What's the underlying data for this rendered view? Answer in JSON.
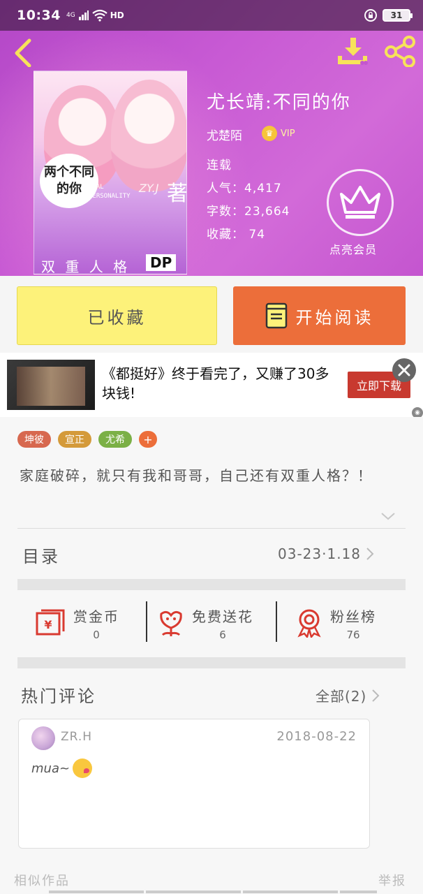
{
  "status_bar": {
    "time": "10:34",
    "network": "4G",
    "hd": "HD",
    "battery": "31"
  },
  "book": {
    "title": "尤长靖:不同的你",
    "author": "尤楚陌",
    "vip_label": "VIP",
    "status": "连载",
    "popularity": "人气：4,417",
    "word_count": "字数：23,664",
    "favorites": "收藏： 74",
    "member_label": "点亮会员",
    "cover": {
      "bubble_text": "两个不同的你",
      "subtitle": "DUAL PERSONALITY",
      "author_mark": "ZY.J",
      "zhu": "著",
      "bottom_text": "双 重 人 格",
      "dp": "DP"
    }
  },
  "actions": {
    "collect_label": "已收藏",
    "read_label": "开始阅读"
  },
  "ad": {
    "text": "《都挺好》终于看完了，又赚了30多块钱!",
    "button_label": "立即下载"
  },
  "tags": [
    {
      "label": "坤彼",
      "color": "#d7684f"
    },
    {
      "label": "宣正",
      "color": "#d49a3a"
    },
    {
      "label": "尤希",
      "color": "#7bb046"
    },
    {
      "label": "+",
      "color": "#ec6e3a"
    }
  ],
  "description": "家庭破碎，就只有我和哥哥，自己还有双重人格？！",
  "catalog": {
    "label": "目录",
    "updated": "03-23·1.18"
  },
  "stats": [
    {
      "label": "赏金币",
      "value": "0",
      "icon": "red-envelope-icon"
    },
    {
      "label": "免费送花",
      "value": "6",
      "icon": "flower-icon"
    },
    {
      "label": "粉丝榜",
      "value": "76",
      "icon": "medal-icon"
    }
  ],
  "comments_section": {
    "title": "热门评论",
    "all_label": "全部(2)",
    "items": [
      {
        "user": "ZR.H",
        "date": "2018-08-22",
        "text": "mua~"
      }
    ]
  },
  "footer": {
    "similar_label": "相似作品",
    "report_label": "举报"
  },
  "colors": {
    "header_purple": "#c455cf",
    "collect_yellow": "#fdf27a",
    "read_orange": "#ec6e3a",
    "icon_red": "#d93a30"
  }
}
